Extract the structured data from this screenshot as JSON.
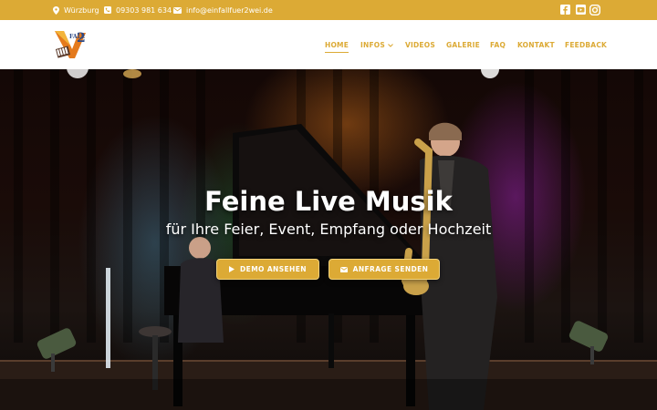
{
  "topbar": {
    "location": "Würzburg",
    "phone": "09303 981 634",
    "email": "info@einfallfuer2wei.de",
    "social": [
      "facebook-icon",
      "youtube-icon",
      "instagram-icon"
    ]
  },
  "logo": {
    "text_top": "FALL",
    "number": "2"
  },
  "nav": {
    "home": "HOME",
    "infos": "INFOS",
    "videos": "VIDEOS",
    "galerie": "GALERIE",
    "faq": "FAQ",
    "kontakt": "KONTAKT",
    "feedback": "FEEDBACK"
  },
  "hero": {
    "title": "Feine Live Musik",
    "subtitle": "für Ihre Feier, Event, Empfang oder Hochzeit",
    "demo_button": "DEMO ANSEHEN",
    "request_button": "ANFRAGE SENDEN"
  },
  "colors": {
    "accent": "#dcaa35",
    "header_bg": "#ffffff",
    "text_light": "#ffffff"
  }
}
